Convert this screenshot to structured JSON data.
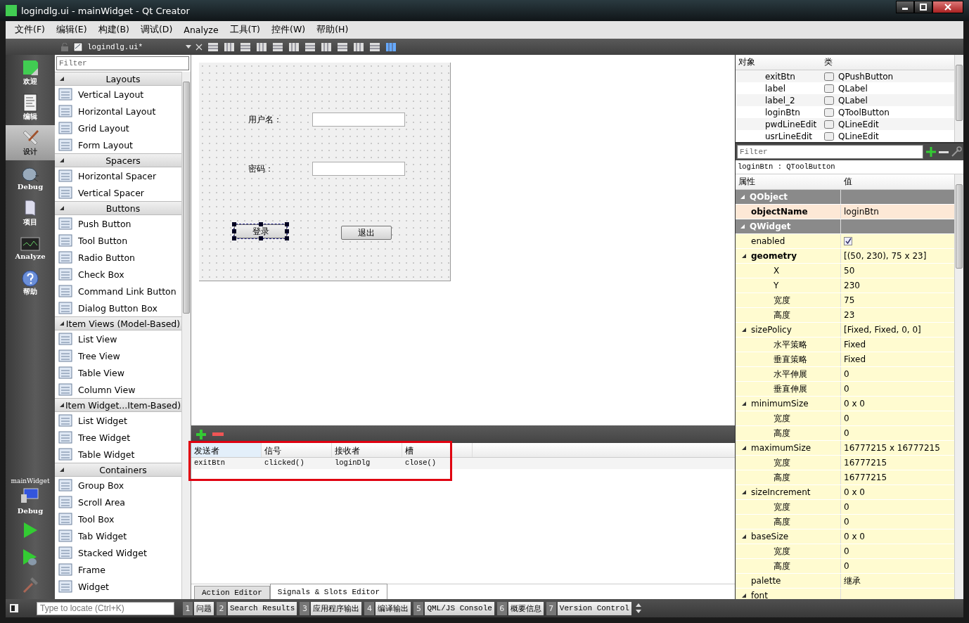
{
  "window": {
    "title": "logindlg.ui - mainWidget - Qt Creator"
  },
  "menu": [
    "文件(F)",
    "编辑(E)",
    "构建(B)",
    "调试(D)",
    "Analyze",
    "工具(T)",
    "控件(W)",
    "帮助(H)"
  ],
  "mode_bar": {
    "modes": [
      {
        "label": "欢迎",
        "selected": false
      },
      {
        "label": "编辑",
        "selected": false
      },
      {
        "label": "设计",
        "selected": true
      },
      {
        "label": "Debug",
        "selected": false
      },
      {
        "label": "项目",
        "selected": false
      },
      {
        "label": "Analyze",
        "selected": false
      },
      {
        "label": "帮助",
        "selected": false
      }
    ],
    "project": "mainWidget",
    "config": "Debug"
  },
  "editor_toolbar": {
    "file": "logindlg.ui*"
  },
  "widget_box": {
    "filter_placeholder": "Filter",
    "categories": [
      {
        "title": "Layouts",
        "expanded": true,
        "items": [
          "Vertical Layout",
          "Horizontal Layout",
          "Grid Layout",
          "Form Layout"
        ]
      },
      {
        "title": "Spacers",
        "expanded": true,
        "items": [
          "Horizontal Spacer",
          "Vertical Spacer"
        ]
      },
      {
        "title": "Buttons",
        "expanded": true,
        "items": [
          "Push Button",
          "Tool Button",
          "Radio Button",
          "Check Box",
          "Command Link Button",
          "Dialog Button Box"
        ]
      },
      {
        "title": "Item Views (Model-Based)",
        "expanded": true,
        "items": [
          "List View",
          "Tree View",
          "Table View",
          "Column View"
        ]
      },
      {
        "title": "Item Widget...Item-Based)",
        "expanded": true,
        "items": [
          "List Widget",
          "Tree Widget",
          "Table Widget"
        ]
      },
      {
        "title": "Containers",
        "expanded": true,
        "items": [
          "Group Box",
          "Scroll Area",
          "Tool Box",
          "Tab Widget",
          "Stacked Widget",
          "Frame",
          "Widget"
        ]
      }
    ]
  },
  "form": {
    "fields": [
      {
        "label": "用户名："
      },
      {
        "label": "密码："
      }
    ],
    "buttons": [
      {
        "label": "登录",
        "selected": true
      },
      {
        "label": "退出",
        "selected": false
      }
    ]
  },
  "connections": {
    "columns": [
      "发送者",
      "信号",
      "接收者",
      "槽"
    ],
    "rows": [
      [
        "exitBtn",
        "clicked()",
        "loginDlg",
        "close()"
      ]
    ]
  },
  "editor_tabs": [
    {
      "label": "Action Editor",
      "selected": false
    },
    {
      "label": "Signals & Slots Editor",
      "selected": true
    }
  ],
  "object_inspector": {
    "columns": [
      "对象",
      "类"
    ],
    "rows": [
      {
        "name": "exitBtn",
        "class": "QPushButton"
      },
      {
        "name": "label",
        "class": "QLabel"
      },
      {
        "name": "label_2",
        "class": "QLabel"
      },
      {
        "name": "loginBtn",
        "class": "QToolButton"
      },
      {
        "name": "pwdLineEdit",
        "class": "QLineEdit"
      },
      {
        "name": "usrLineEdit",
        "class": "QLineEdit"
      }
    ]
  },
  "property_editor": {
    "filter_placeholder": "Filter",
    "object": "loginBtn : QToolButton",
    "columns": [
      "属性",
      "值"
    ],
    "rows": [
      {
        "kind": "group",
        "name": "QObject",
        "expanded": true,
        "children": [
          {
            "kind": "prop",
            "name": "objectName",
            "value": "loginBtn",
            "modified": true
          }
        ]
      },
      {
        "kind": "group",
        "name": "QWidget",
        "expanded": true,
        "children": [
          {
            "kind": "check",
            "name": "enabled",
            "checked": true,
            "modified": false
          },
          {
            "kind": "prop",
            "name": "geometry",
            "value": "[(50, 230), 75 x 23]",
            "modified": true,
            "expanded": true,
            "children": [
              {
                "kind": "prop",
                "name": "X",
                "value": "50",
                "modified": false
              },
              {
                "kind": "prop",
                "name": "Y",
                "value": "230",
                "modified": false
              },
              {
                "kind": "prop",
                "name": "宽度",
                "value": "75",
                "modified": false
              },
              {
                "kind": "prop",
                "name": "高度",
                "value": "23",
                "modified": false
              }
            ]
          },
          {
            "kind": "prop",
            "name": "sizePolicy",
            "value": "[Fixed, Fixed, 0, 0]",
            "modified": false,
            "expanded": true,
            "children": [
              {
                "kind": "prop",
                "name": "水平策略",
                "value": "Fixed",
                "modified": false
              },
              {
                "kind": "prop",
                "name": "垂直策略",
                "value": "Fixed",
                "modified": false
              },
              {
                "kind": "prop",
                "name": "水平伸展",
                "value": "0",
                "modified": false
              },
              {
                "kind": "prop",
                "name": "垂直伸展",
                "value": "0",
                "modified": false
              }
            ]
          },
          {
            "kind": "prop",
            "name": "minimumSize",
            "value": "0 x 0",
            "modified": false,
            "expanded": true,
            "children": [
              {
                "kind": "prop",
                "name": "宽度",
                "value": "0",
                "modified": false
              },
              {
                "kind": "prop",
                "name": "高度",
                "value": "0",
                "modified": false
              }
            ]
          },
          {
            "kind": "prop",
            "name": "maximumSize",
            "value": "16777215 x 16777215",
            "modified": false,
            "expanded": true,
            "children": [
              {
                "kind": "prop",
                "name": "宽度",
                "value": "16777215",
                "modified": false
              },
              {
                "kind": "prop",
                "name": "高度",
                "value": "16777215",
                "modified": false
              }
            ]
          },
          {
            "kind": "prop",
            "name": "sizeIncrement",
            "value": "0 x 0",
            "modified": false,
            "expanded": true,
            "children": [
              {
                "kind": "prop",
                "name": "宽度",
                "value": "0",
                "modified": false
              },
              {
                "kind": "prop",
                "name": "高度",
                "value": "0",
                "modified": false
              }
            ]
          },
          {
            "kind": "prop",
            "name": "baseSize",
            "value": "0 x 0",
            "modified": false,
            "expanded": true,
            "children": [
              {
                "kind": "prop",
                "name": "宽度",
                "value": "0",
                "modified": false
              },
              {
                "kind": "prop",
                "name": "高度",
                "value": "0",
                "modified": false
              }
            ]
          },
          {
            "kind": "prop",
            "name": "palette",
            "value": "继承",
            "modified": false
          },
          {
            "kind": "prop",
            "name": "font",
            "modified": false,
            "expanded": true
          }
        ]
      }
    ]
  },
  "locator": {
    "placeholder": "Type to locate (Ctrl+K)"
  },
  "output_panes": [
    {
      "number": "1",
      "label": "问题"
    },
    {
      "number": "2",
      "label": "Search Results"
    },
    {
      "number": "3",
      "label": "应用程序输出"
    },
    {
      "number": "4",
      "label": "编译输出"
    },
    {
      "number": "5",
      "label": "QML/JS Console"
    },
    {
      "number": "6",
      "label": "概要信息"
    },
    {
      "number": "7",
      "label": "Version Control"
    }
  ]
}
